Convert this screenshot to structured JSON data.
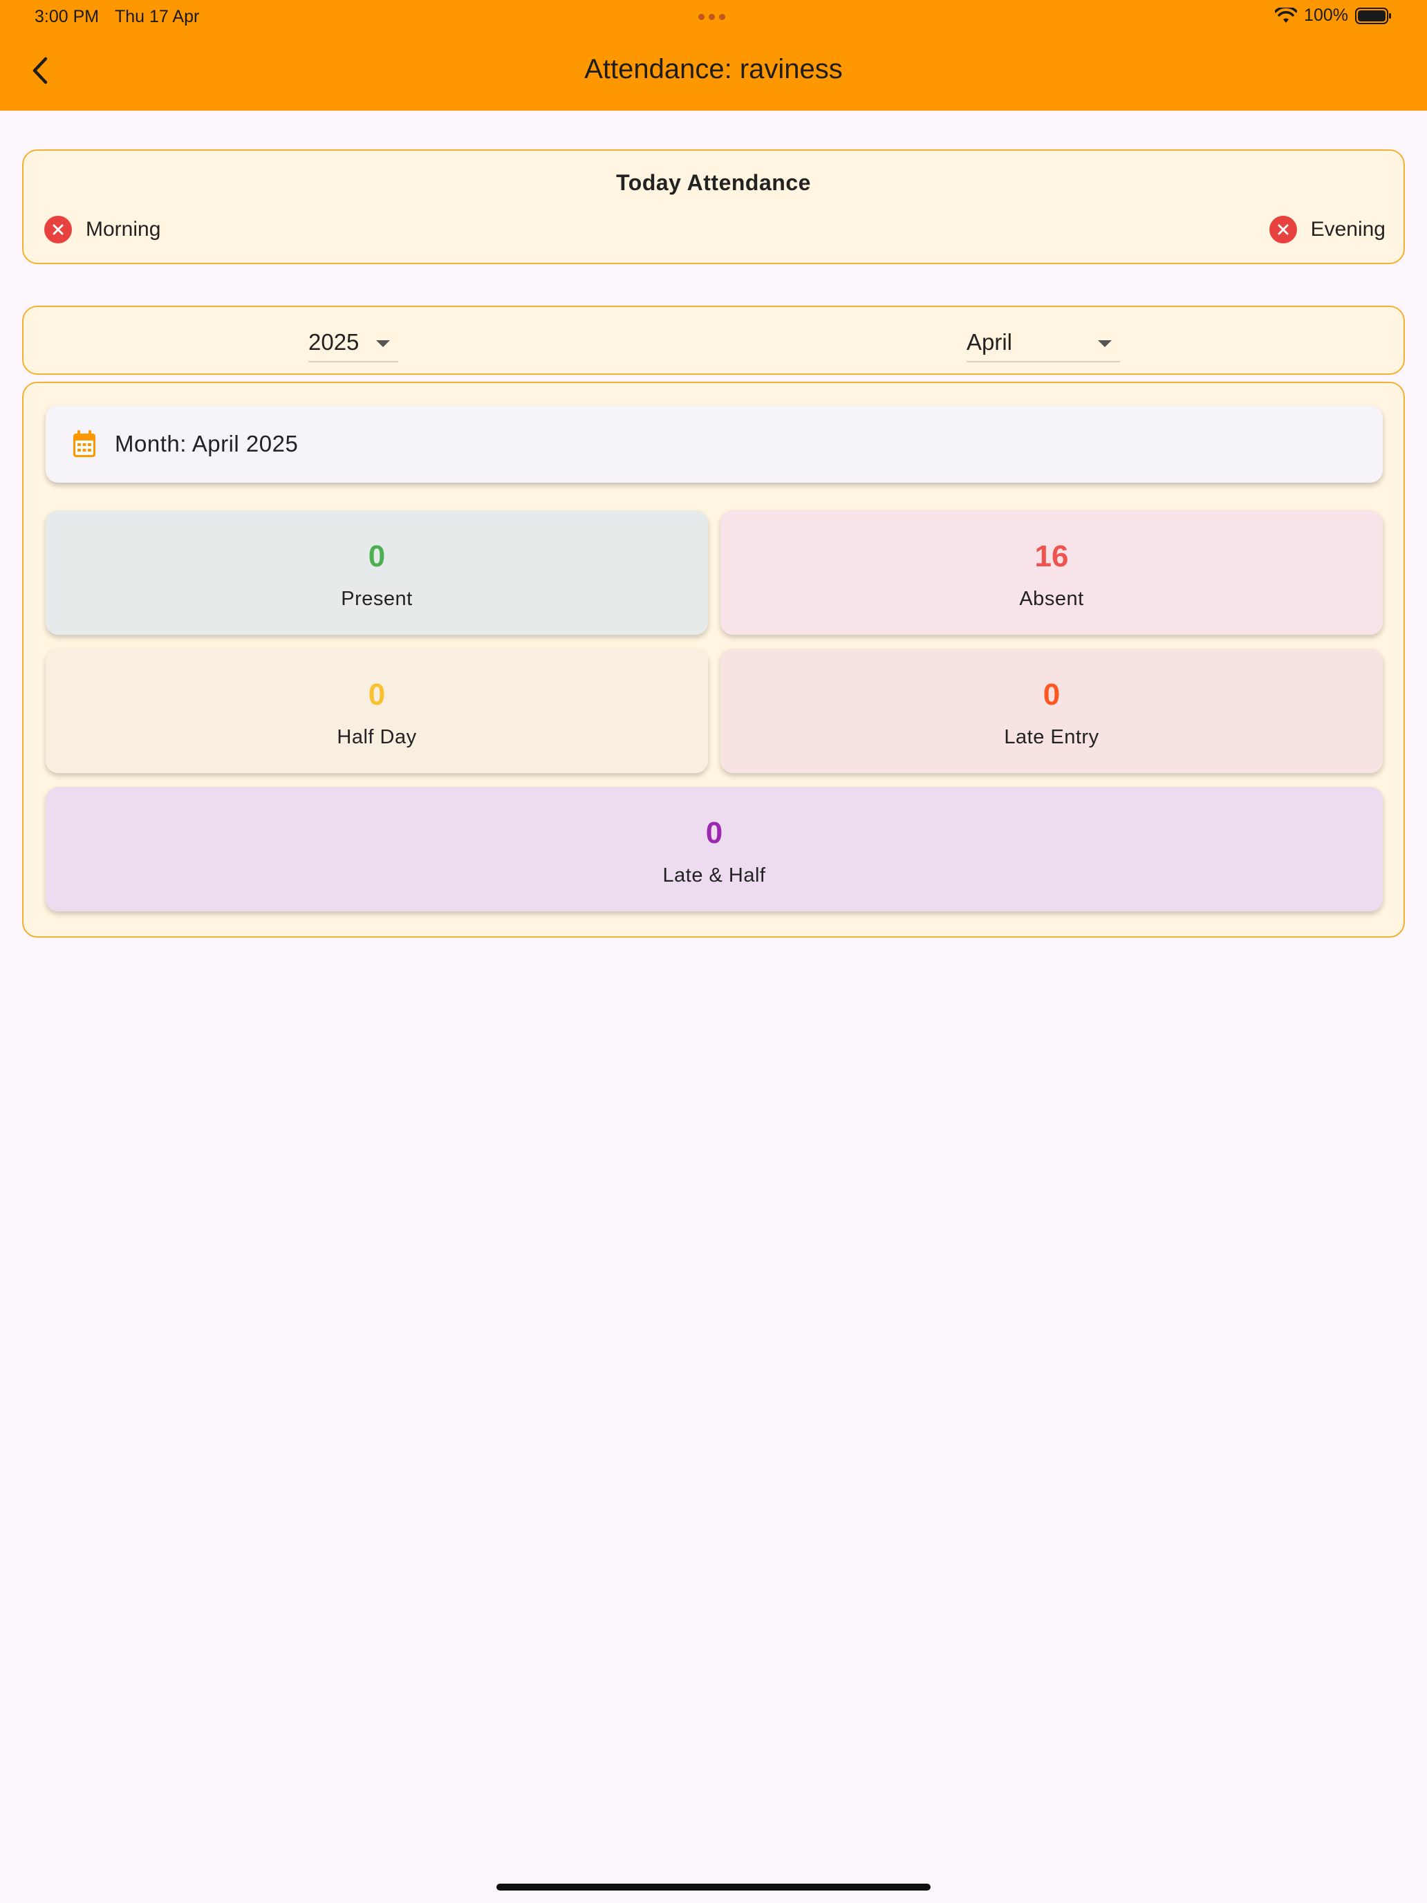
{
  "status_bar": {
    "time": "3:00 PM",
    "date": "Thu 17 Apr",
    "battery": "100%"
  },
  "app_bar": {
    "title": "Attendance: raviness"
  },
  "today": {
    "title": "Today Attendance",
    "morning": "Morning",
    "evening": "Evening"
  },
  "filters": {
    "year": "2025",
    "month": "April"
  },
  "summary": {
    "month_label": "Month: April 2025",
    "present": {
      "value": "0",
      "label": "Present",
      "color": "#4caf50"
    },
    "absent": {
      "value": "16",
      "label": "Absent",
      "color": "#ef5350"
    },
    "half_day": {
      "value": "0",
      "label": "Half Day",
      "color": "#fbc02d"
    },
    "late_entry": {
      "value": "0",
      "label": "Late Entry",
      "color": "#ff5722"
    },
    "late_half": {
      "value": "0",
      "label": "Late & Half",
      "color": "#9c27b0"
    }
  },
  "colors": {
    "accent": "#ff9800",
    "card_bg": "#fff5e0",
    "card_border": "#f5b02f",
    "error": "#e84240"
  }
}
